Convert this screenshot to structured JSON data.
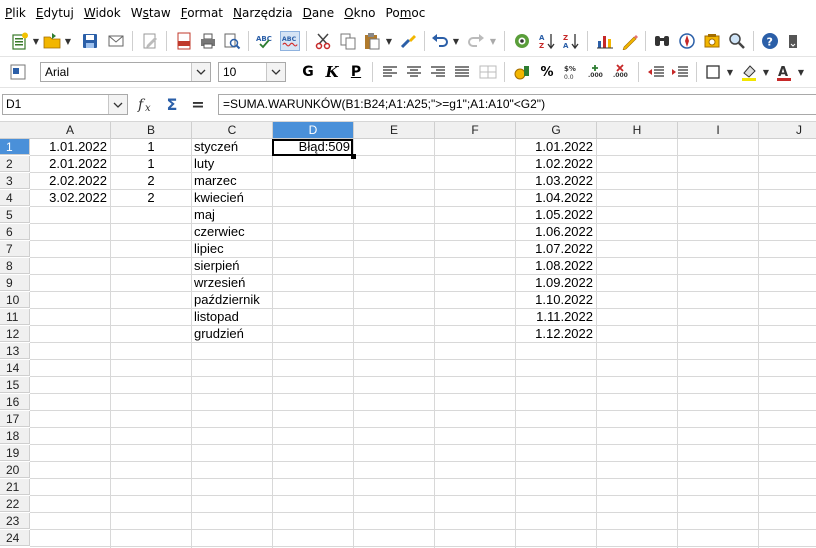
{
  "menu": [
    "Plik",
    "Edytuj",
    "Widok",
    "Wstaw",
    "Format",
    "Narzędzia",
    "Dane",
    "Okno",
    "Pomoc"
  ],
  "menu_underline": [
    "P",
    "E",
    "W",
    "s",
    "F",
    "N",
    "D",
    "O",
    "m"
  ],
  "toolbar": {
    "font_name": "Arial",
    "font_size": "10",
    "bold": "G",
    "italic": "K",
    "underline": "P",
    "percent": "%"
  },
  "formula_bar": {
    "cell_ref": "D1",
    "sigma": "Σ",
    "equals": "=",
    "formula": "=SUMA.WARUNKÓW(B1:B24;A1:A25;\">=g1\";A1:A10\"<G2\")"
  },
  "columns": [
    "A",
    "B",
    "C",
    "D",
    "E",
    "F",
    "G",
    "H",
    "I",
    "J"
  ],
  "rows": [
    "1",
    "2",
    "3",
    "4",
    "5",
    "6",
    "7",
    "8",
    "9",
    "10",
    "11",
    "12",
    "13",
    "14",
    "15",
    "16",
    "17",
    "18",
    "19",
    "20",
    "21",
    "22",
    "23",
    "24"
  ],
  "cells": {
    "A": [
      "1.01.2022",
      "2.01.2022",
      "2.02.2022",
      "3.02.2022"
    ],
    "B": [
      "1",
      "1",
      "2",
      "2"
    ],
    "C": [
      "styczeń",
      "luty",
      "marzec",
      "kwiecień",
      "maj",
      "czerwiec",
      "lipiec",
      "sierpień",
      "wrzesień",
      "październik",
      "listopad",
      "grudzień"
    ],
    "D": [
      "Błąd:509"
    ],
    "G": [
      "1.01.2022",
      "1.02.2022",
      "1.03.2022",
      "1.04.2022",
      "1.05.2022",
      "1.06.2022",
      "1.07.2022",
      "1.08.2022",
      "1.09.2022",
      "1.10.2022",
      "1.11.2022",
      "1.12.2022"
    ]
  },
  "active": {
    "column": "D",
    "row": "1"
  },
  "colors": {
    "header_active": "#4a90d9",
    "header_bg": "#f0f0f0",
    "gridline": "#d8d8d8"
  }
}
